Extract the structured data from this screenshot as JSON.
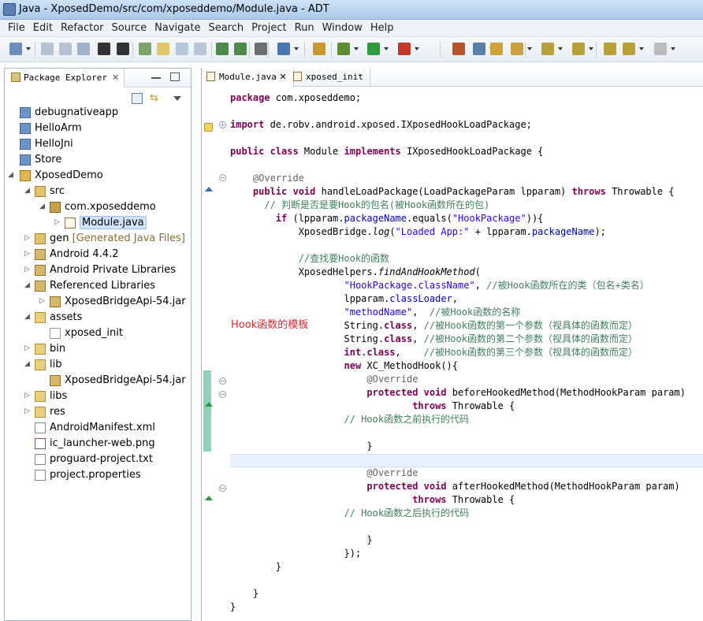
{
  "window": {
    "title": "Java - XposedDemo/src/com/xposeddemo/Module.java - ADT"
  },
  "menu": [
    "File",
    "Edit",
    "Refactor",
    "Source",
    "Navigate",
    "Search",
    "Project",
    "Run",
    "Window",
    "Help"
  ],
  "package_explorer": {
    "tab_label": "Package Explorer",
    "tree": [
      {
        "label": "debugnativeapp",
        "indent": 0,
        "icon": "project-folder-icon"
      },
      {
        "label": "HelloArm",
        "indent": 0,
        "icon": "project-folder-icon"
      },
      {
        "label": "HelloJni",
        "indent": 0,
        "icon": "project-folder-icon"
      },
      {
        "label": "Store",
        "indent": 0,
        "icon": "project-folder-icon"
      },
      {
        "label": "XposedDemo",
        "indent": 0,
        "icon": "android-project-icon",
        "expanded": true
      },
      {
        "label": "src",
        "indent": 1,
        "icon": "source-folder-icon",
        "expanded": true
      },
      {
        "label": "com.xposeddemo",
        "indent": 2,
        "icon": "package-icon",
        "expanded": true
      },
      {
        "label": "Module.java",
        "indent": 3,
        "icon": "java-file-icon",
        "collapsed": true,
        "selected": true
      },
      {
        "label": "gen",
        "extra": "[Generated Java Files]",
        "indent": 1,
        "icon": "source-folder-icon",
        "collapsed": true
      },
      {
        "label": "Android 4.4.2",
        "indent": 1,
        "icon": "library-icon",
        "collapsed": true
      },
      {
        "label": "Android Private Libraries",
        "indent": 1,
        "icon": "library-icon",
        "collapsed": true
      },
      {
        "label": "Referenced Libraries",
        "indent": 1,
        "icon": "library-icon",
        "expanded": true
      },
      {
        "label": "XposedBridgeApi-54.jar",
        "indent": 2,
        "icon": "jar-icon",
        "collapsed": true
      },
      {
        "label": "assets",
        "indent": 1,
        "icon": "folder-icon",
        "expanded": true
      },
      {
        "label": "xposed_init",
        "indent": 2,
        "icon": "file-icon"
      },
      {
        "label": "bin",
        "indent": 1,
        "icon": "folder-icon",
        "collapsed": true
      },
      {
        "label": "lib",
        "indent": 1,
        "icon": "folder-icon",
        "expanded": true
      },
      {
        "label": "XposedBridgeApi-54.jar",
        "indent": 2,
        "icon": "jar-icon"
      },
      {
        "label": "libs",
        "indent": 1,
        "icon": "folder-icon",
        "collapsed": true
      },
      {
        "label": "res",
        "indent": 1,
        "icon": "folder-icon",
        "collapsed": true
      },
      {
        "label": "AndroidManifest.xml",
        "indent": 1,
        "icon": "xml-file-icon"
      },
      {
        "label": "ic_launcher-web.png",
        "indent": 1,
        "icon": "image-file-icon"
      },
      {
        "label": "proguard-project.txt",
        "indent": 1,
        "icon": "text-file-icon"
      },
      {
        "label": "project.properties",
        "indent": 1,
        "icon": "properties-file-icon"
      }
    ]
  },
  "editor": {
    "tabs": [
      {
        "label": "Module.java",
        "active": true
      },
      {
        "label": "xposed_init",
        "active": false
      }
    ],
    "lines": [
      [
        {
          "t": "package ",
          "c": "kw"
        },
        {
          "t": "com.xposeddemo;"
        }
      ],
      [],
      [
        {
          "t": "import ",
          "c": "kw"
        },
        {
          "t": "de.robv.android.xposed.IXposedHookLoadPackage;"
        }
      ],
      [],
      [
        {
          "t": "public class ",
          "c": "kw"
        },
        {
          "t": "Module "
        },
        {
          "t": "implements ",
          "c": "kw"
        },
        {
          "t": "IXposedHookLoadPackage {"
        }
      ],
      [],
      [
        {
          "t": "    "
        },
        {
          "t": "@Override",
          "c": "an"
        }
      ],
      [
        {
          "t": "    "
        },
        {
          "t": "public void ",
          "c": "kw"
        },
        {
          "t": "handleLoadPackage(LoadPackageParam lpparam) "
        },
        {
          "t": "throws ",
          "c": "kw"
        },
        {
          "t": "Throwable {"
        }
      ],
      [
        {
          "t": "      "
        },
        {
          "t": "// 判断是否是要Hook的包名(被Hook函数所在的包)",
          "c": "cm"
        }
      ],
      [
        {
          "t": "        "
        },
        {
          "t": "if ",
          "c": "kw"
        },
        {
          "t": "(lpparam."
        },
        {
          "t": "packageName",
          "c": "fld"
        },
        {
          "t": ".equals("
        },
        {
          "t": "\"HookPackage\"",
          "c": "str"
        },
        {
          "t": ")){"
        }
      ],
      [
        {
          "t": "            XposedBridge."
        },
        {
          "t": "log",
          "c": "it"
        },
        {
          "t": "("
        },
        {
          "t": "\"Loaded App:\"",
          "c": "str"
        },
        {
          "t": " + lpparam."
        },
        {
          "t": "packageName",
          "c": "fld"
        },
        {
          "t": ");"
        }
      ],
      [],
      [
        {
          "t": "            "
        },
        {
          "t": "//查找要Hook的函数",
          "c": "cm"
        }
      ],
      [
        {
          "t": "            XposedHelpers."
        },
        {
          "t": "findAndHookMethod",
          "c": "it"
        },
        {
          "t": "("
        }
      ],
      [
        {
          "t": "                    "
        },
        {
          "t": "\"HookPackage.className\"",
          "c": "str"
        },
        {
          "t": ", "
        },
        {
          "t": "//被Hook函数所在的类（包名+类名）",
          "c": "cm"
        }
      ],
      [
        {
          "t": "                    lpparam."
        },
        {
          "t": "classLoader",
          "c": "fld"
        },
        {
          "t": ","
        }
      ],
      [
        {
          "t": "                    "
        },
        {
          "t": "\"methodName\"",
          "c": "str"
        },
        {
          "t": ",  "
        },
        {
          "t": "//被Hook函数的名称",
          "c": "cm"
        }
      ],
      [
        {
          "t": "                    String."
        },
        {
          "t": "class",
          "c": "kw"
        },
        {
          "t": ", "
        },
        {
          "t": "//被Hook函数的第一个参数（视具体的函数而定）",
          "c": "cm"
        }
      ],
      [
        {
          "t": "                    String."
        },
        {
          "t": "class",
          "c": "kw"
        },
        {
          "t": ", "
        },
        {
          "t": "//被Hook函数的第二个参数（视具体的函数而定）",
          "c": "cm"
        }
      ],
      [
        {
          "t": "                    "
        },
        {
          "t": "int",
          "c": "kw"
        },
        {
          "t": "."
        },
        {
          "t": "class",
          "c": "kw"
        },
        {
          "t": ",    "
        },
        {
          "t": "//被Hook函数的第三个参数（视具体的函数而定）",
          "c": "cm"
        }
      ],
      [
        {
          "t": "                    "
        },
        {
          "t": "new ",
          "c": "kw"
        },
        {
          "t": "XC_MethodHook(){"
        }
      ],
      [
        {
          "t": "                        "
        },
        {
          "t": "@Override",
          "c": "an"
        }
      ],
      [
        {
          "t": "                        "
        },
        {
          "t": "protected void ",
          "c": "kw"
        },
        {
          "t": "beforeHookedMethod(MethodHookParam param)"
        }
      ],
      [
        {
          "t": "                                "
        },
        {
          "t": "throws ",
          "c": "kw"
        },
        {
          "t": "Throwable {"
        }
      ],
      [
        {
          "t": "                    "
        },
        {
          "t": "// Hook函数之前执行的代码",
          "c": "cm"
        }
      ],
      [],
      [
        {
          "t": "                        }"
        }
      ],
      [],
      [
        {
          "t": "                        "
        },
        {
          "t": "@Override",
          "c": "an"
        }
      ],
      [
        {
          "t": "                        "
        },
        {
          "t": "protected void ",
          "c": "kw"
        },
        {
          "t": "afterHookedMethod(MethodHookParam param)"
        }
      ],
      [
        {
          "t": "                                "
        },
        {
          "t": "throws ",
          "c": "kw"
        },
        {
          "t": "Throwable {"
        }
      ],
      [
        {
          "t": "                    "
        },
        {
          "t": "// Hook函数之后执行的代码",
          "c": "cm"
        }
      ],
      [],
      [
        {
          "t": "                        }"
        }
      ],
      [
        {
          "t": "                    });"
        }
      ],
      [
        {
          "t": "        }"
        }
      ],
      [],
      [
        {
          "t": "    }"
        }
      ],
      [
        {
          "t": "}"
        }
      ]
    ]
  },
  "annotation": "Hook函数的模板"
}
